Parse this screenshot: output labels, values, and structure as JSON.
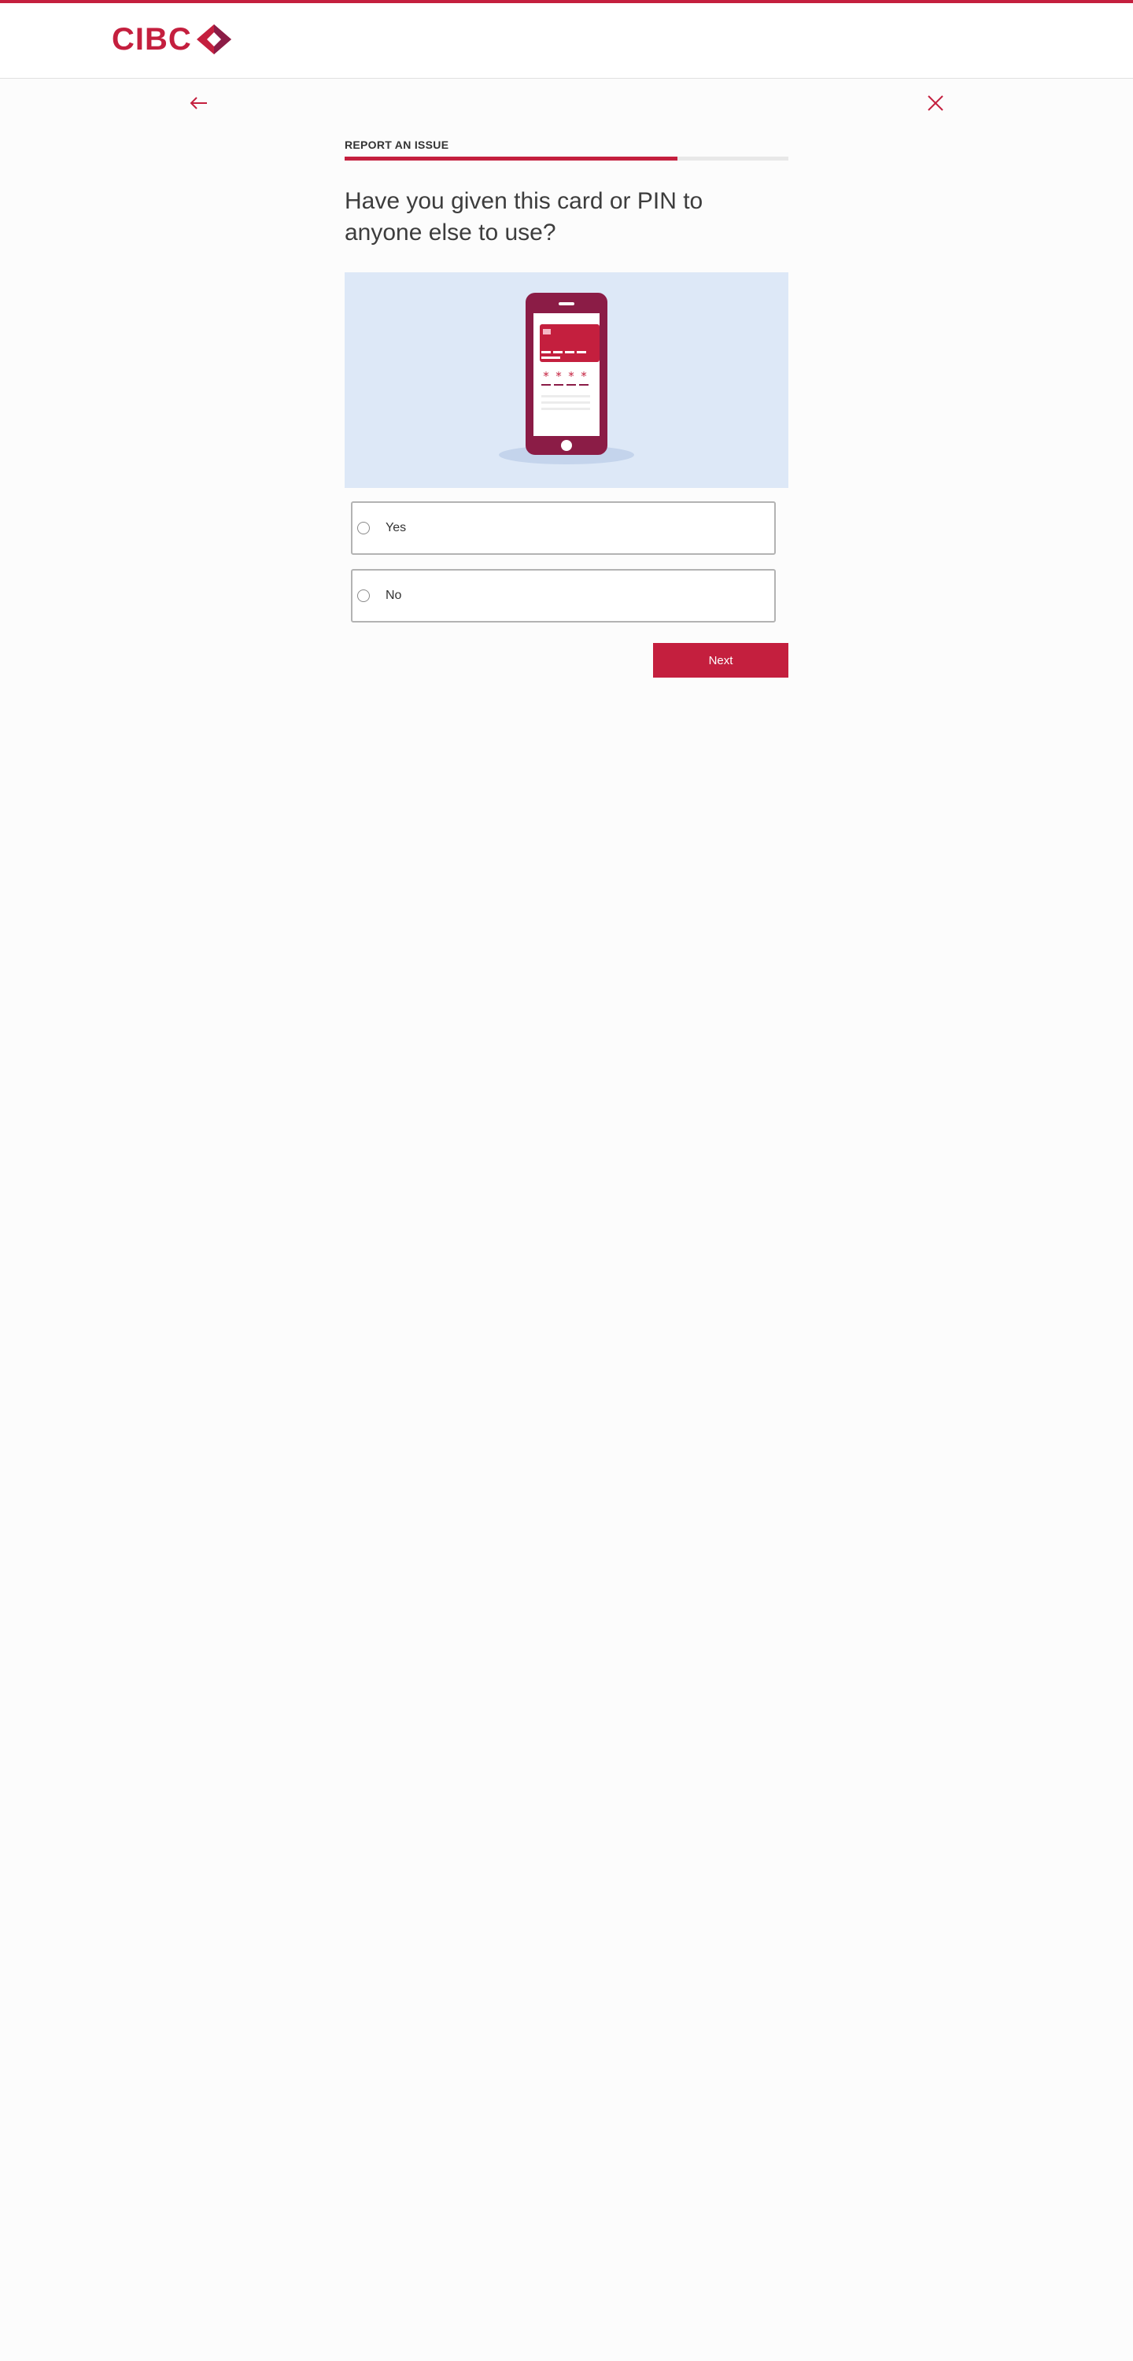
{
  "brand": {
    "name": "CIBC",
    "accent_color": "#c41f3e",
    "dark_accent_color": "#8b1c46",
    "logo_icon": "cibc-diamond-logo"
  },
  "nav": {
    "back_icon": "arrow-left-icon",
    "close_icon": "close-icon"
  },
  "step": {
    "eyebrow": "REPORT AN ISSUE",
    "progress_fraction": 0.75
  },
  "question": {
    "text": "Have you given this card or PIN to anyone else to use?"
  },
  "illustration": {
    "icon": "phone-card-pin-illustration",
    "background_color": "#dde8f7"
  },
  "options": [
    {
      "label": "Yes",
      "selected": false
    },
    {
      "label": "No",
      "selected": false
    }
  ],
  "actions": {
    "next_label": "Next"
  }
}
